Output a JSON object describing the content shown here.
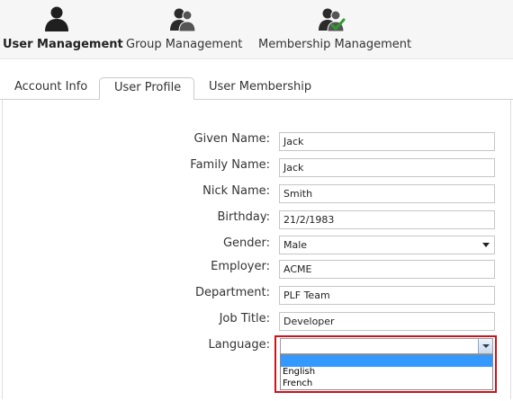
{
  "nav": {
    "items": [
      {
        "label": "User Management",
        "icon": "user-icon",
        "active": true
      },
      {
        "label": "Group Management",
        "icon": "group-icon",
        "active": false
      },
      {
        "label": "Membership Management",
        "icon": "membership-icon",
        "active": false
      }
    ]
  },
  "tabs": [
    {
      "label": "Account Info",
      "active": false
    },
    {
      "label": "User Profile",
      "active": true
    },
    {
      "label": "User Membership",
      "active": false
    }
  ],
  "form": {
    "given_name": {
      "label": "Given Name:",
      "value": "Jack"
    },
    "family_name": {
      "label": "Family Name:",
      "value": "Jack"
    },
    "nick_name": {
      "label": "Nick Name:",
      "value": "Smith"
    },
    "birthday": {
      "label": "Birthday:",
      "value": "21/2/1983"
    },
    "gender": {
      "label": "Gender:",
      "value": "Male"
    },
    "employer": {
      "label": "Employer:",
      "value": "ACME"
    },
    "department": {
      "label": "Department:",
      "value": "PLF Team"
    },
    "job_title": {
      "label": "Job Title:",
      "value": "Developer"
    },
    "language": {
      "label": "Language:",
      "value": "",
      "options": [
        "",
        "English",
        "French"
      ]
    }
  },
  "colors": {
    "highlight_border": "#c8141f",
    "selected_option": "#3399ff",
    "membership_check": "#2e9b2e"
  }
}
